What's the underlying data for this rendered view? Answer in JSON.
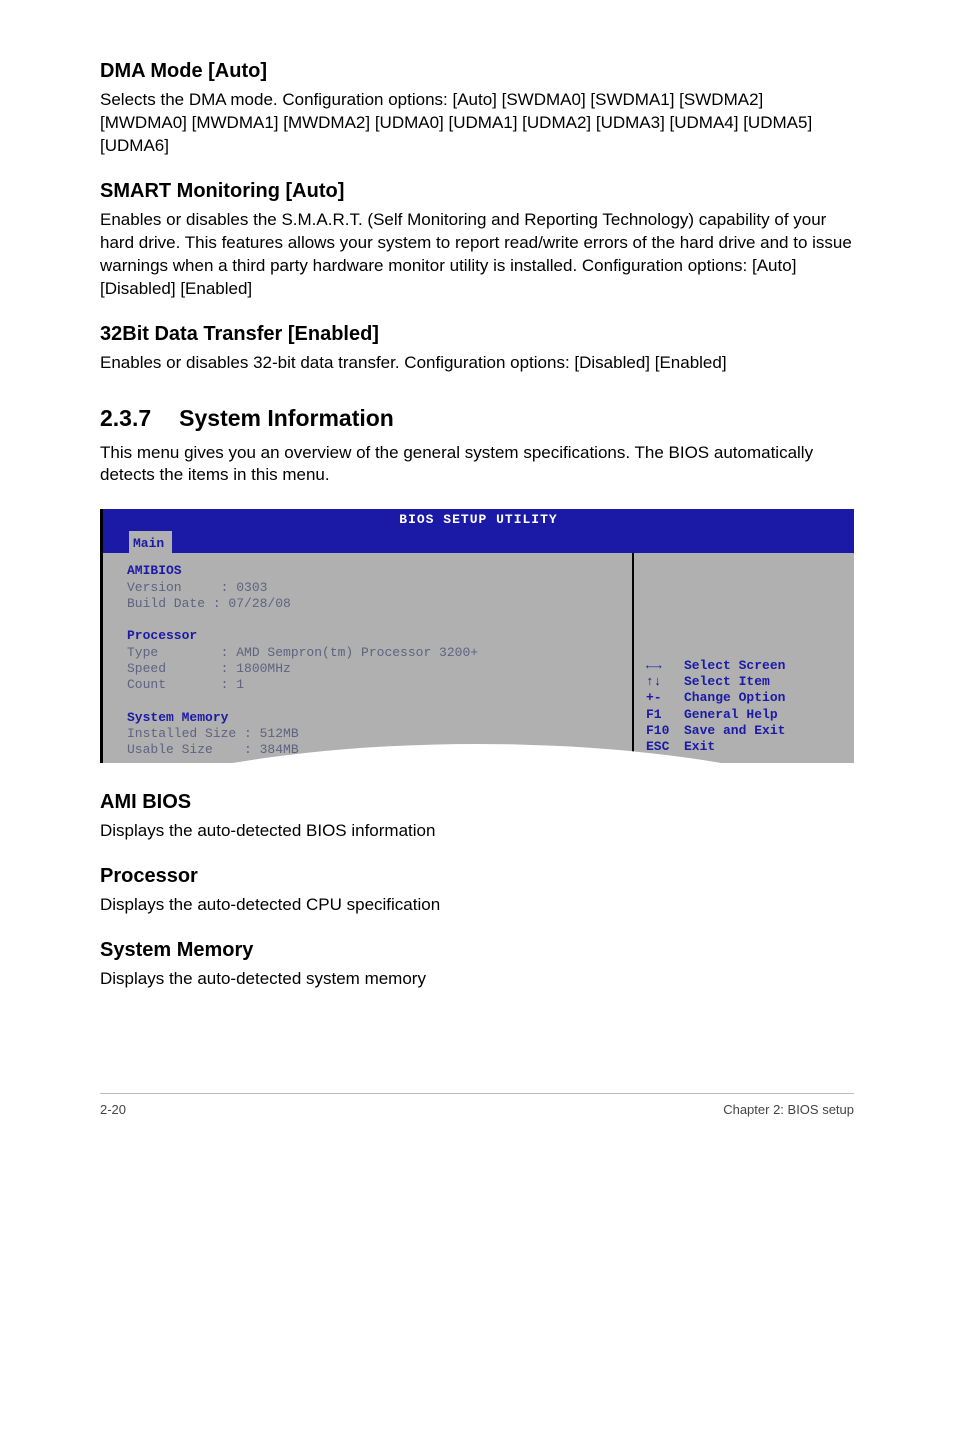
{
  "section1": {
    "title": "DMA Mode [Auto]",
    "body": "Selects the DMA mode. Configuration options: [Auto] [SWDMA0] [SWDMA1] [SWDMA2] [MWDMA0] [MWDMA1] [MWDMA2] [UDMA0] [UDMA1] [UDMA2] [UDMA3] [UDMA4] [UDMA5] [UDMA6]"
  },
  "section2": {
    "title": "SMART Monitoring [Auto]",
    "body": "Enables or disables the S.M.A.R.T. (Self Monitoring and Reporting Technology) capability of your hard drive. This features allows your system to report read/write errors of the hard drive and to issue warnings when a third party hardware monitor utility is installed. Configuration options: [Auto] [Disabled] [Enabled]"
  },
  "section3": {
    "title": "32Bit Data Transfer [Enabled]",
    "body": "Enables or disables 32-bit data transfer. Configuration options: [Disabled] [Enabled]"
  },
  "sys_info": {
    "number": "2.3.7",
    "title": "System Information",
    "body": "This menu gives you an overview of the general system specifications. The BIOS automatically detects the items in this menu."
  },
  "bios": {
    "titlebar": "BIOS SETUP UTILITY",
    "tab": "Main",
    "amibios_label": "AMIBIOS",
    "version_row": "Version     : 0303",
    "build_row": "Build Date : 07/28/08",
    "processor_label": "Processor",
    "type_row": "Type        : AMD Sempron(tm) Processor 3200+",
    "speed_row": "Speed       : 1800MHz",
    "count_row": "Count       : 1",
    "sysmem_label": "System Memory",
    "installed_row": "Installed Size : 512MB",
    "usable_row": "Usable Size    : 384MB",
    "help": {
      "k1": "←→",
      "v1": "Select Screen",
      "k2": "↑↓",
      "v2": "Select Item",
      "k3": "+-",
      "v3": "Change Option",
      "k4": "F1",
      "v4": "General Help",
      "k5": "F10",
      "v5": "Save and Exit",
      "k6": "ESC",
      "v6": "Exit"
    }
  },
  "post1": {
    "title": "AMI BIOS",
    "body": "Displays the auto-detected BIOS information"
  },
  "post2": {
    "title": "Processor",
    "body": "Displays the auto-detected CPU specification"
  },
  "post3": {
    "title": "System Memory",
    "body": "Displays the auto-detected system memory"
  },
  "footer": {
    "left": "2-20",
    "right": "Chapter 2: BIOS setup"
  }
}
